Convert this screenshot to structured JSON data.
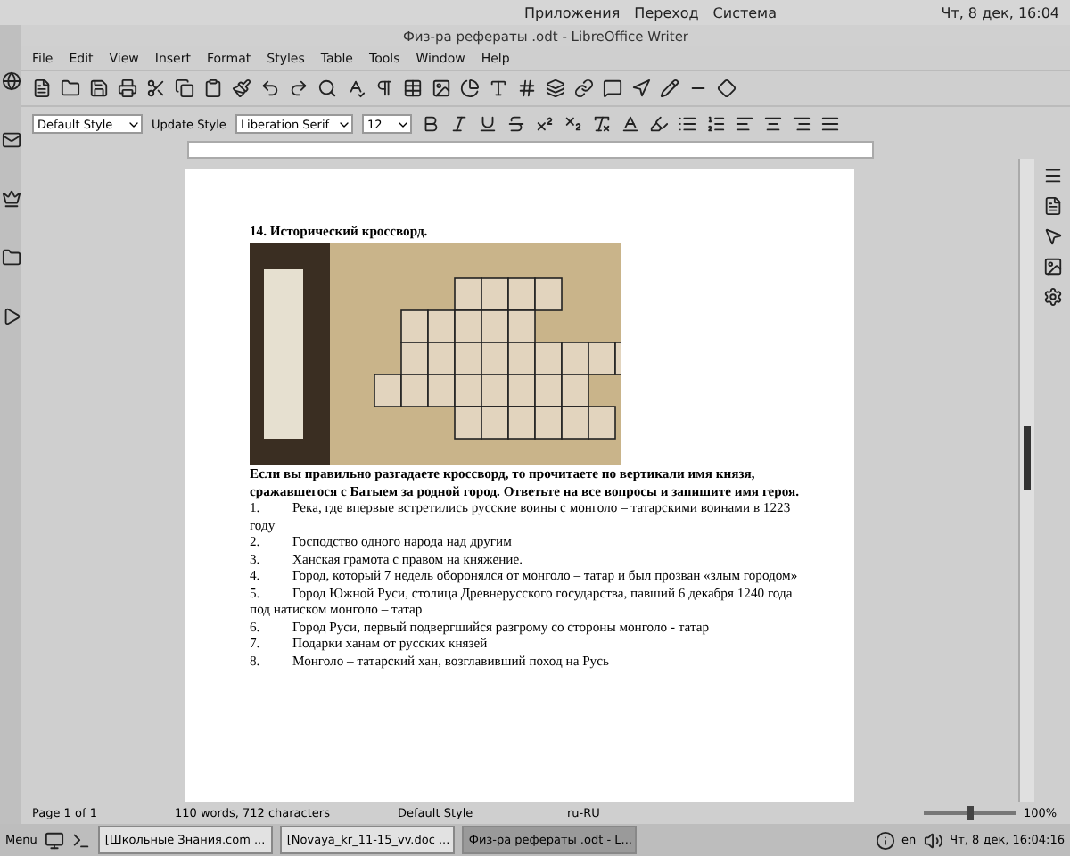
{
  "top_panel": {
    "menus": [
      "Приложения",
      "Переход",
      "Система"
    ],
    "clock": "Чт, 8 дек, 16:04"
  },
  "window": {
    "title": "Физ-ра рефераты .odt - LibreOffice Writer"
  },
  "menu": [
    "File",
    "Edit",
    "View",
    "Insert",
    "Format",
    "Styles",
    "Table",
    "Tools",
    "Window",
    "Help"
  ],
  "format_toolbar": {
    "paragraph_style": "Default Style",
    "update_style": "Update Style",
    "font": "Liberation Serif",
    "size": "12"
  },
  "document": {
    "heading": "14. Исторический кроссворд.",
    "paragraph": "Если вы правильно разгадаете кроссворд, то прочитаете по вертикали имя князя, сражавшегося с Батыем за родной город. Ответьте на все вопросы и запишите имя героя.",
    "items": [
      {
        "number": "1.",
        "text": "Река, где впервые встретились русские  воины с монголо – татарскими воинами в 1223 году"
      },
      {
        "number": "2.",
        "text": "Господство одного народа над другим"
      },
      {
        "number": "3.",
        "text": "Ханская грамота с правом на княжение."
      },
      {
        "number": "4.",
        "text": "Город, который 7 недель оборонялся от  монголо – татар и был прозван «злым городом»"
      },
      {
        "number": "5.",
        "text": "Город Южной Руси, столица Древнерусского государства, павший 6 декабря 1240 года под  натиском монголо – татар"
      },
      {
        "number": "6.",
        "text": "Город Руси, первый подвергшийся  разгрому со стороны монголо - татар"
      },
      {
        "number": "7.",
        "text": "Подарки ханам от русских князей"
      },
      {
        "number": "8.",
        "text": "Монголо – татарский хан, возглавивший поход на Русь"
      }
    ]
  },
  "status_bar": {
    "page": "Page 1 of 1",
    "words": "110 words, 712 characters",
    "style": "Default Style",
    "language": "ru-RU",
    "zoom": "100%",
    "zoom_slider": {
      "level": 0.5
    }
  },
  "taskbar": {
    "menu": "Menu",
    "tasks": [
      {
        "label": "[Школьные Знания.com ...",
        "selected": false
      },
      {
        "label": "[Novaya_kr_11-15_vv.doc ...",
        "selected": false
      },
      {
        "label": "Физ-ра рефераты .odt - L...",
        "selected": true
      }
    ],
    "keyboard": "en",
    "clock": "Чт, 8 дек, 16:04:16"
  }
}
